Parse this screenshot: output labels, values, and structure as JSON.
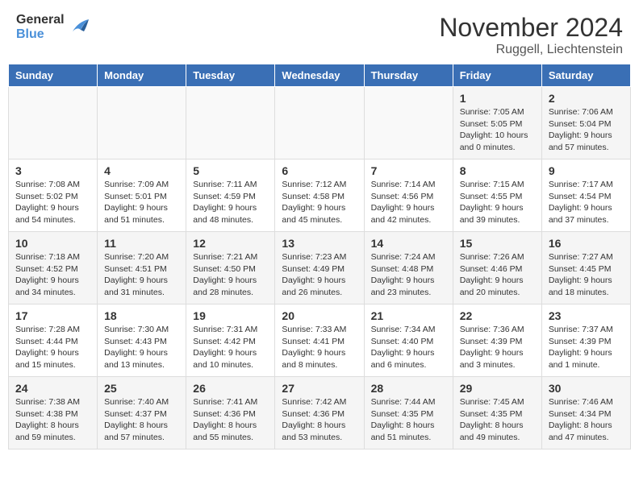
{
  "header": {
    "logo_general": "General",
    "logo_blue": "Blue",
    "month_title": "November 2024",
    "location": "Ruggell, Liechtenstein"
  },
  "weekdays": [
    "Sunday",
    "Monday",
    "Tuesday",
    "Wednesday",
    "Thursday",
    "Friday",
    "Saturday"
  ],
  "weeks": [
    [
      {
        "day": "",
        "info": ""
      },
      {
        "day": "",
        "info": ""
      },
      {
        "day": "",
        "info": ""
      },
      {
        "day": "",
        "info": ""
      },
      {
        "day": "",
        "info": ""
      },
      {
        "day": "1",
        "info": "Sunrise: 7:05 AM\nSunset: 5:05 PM\nDaylight: 10 hours and 0 minutes."
      },
      {
        "day": "2",
        "info": "Sunrise: 7:06 AM\nSunset: 5:04 PM\nDaylight: 9 hours and 57 minutes."
      }
    ],
    [
      {
        "day": "3",
        "info": "Sunrise: 7:08 AM\nSunset: 5:02 PM\nDaylight: 9 hours and 54 minutes."
      },
      {
        "day": "4",
        "info": "Sunrise: 7:09 AM\nSunset: 5:01 PM\nDaylight: 9 hours and 51 minutes."
      },
      {
        "day": "5",
        "info": "Sunrise: 7:11 AM\nSunset: 4:59 PM\nDaylight: 9 hours and 48 minutes."
      },
      {
        "day": "6",
        "info": "Sunrise: 7:12 AM\nSunset: 4:58 PM\nDaylight: 9 hours and 45 minutes."
      },
      {
        "day": "7",
        "info": "Sunrise: 7:14 AM\nSunset: 4:56 PM\nDaylight: 9 hours and 42 minutes."
      },
      {
        "day": "8",
        "info": "Sunrise: 7:15 AM\nSunset: 4:55 PM\nDaylight: 9 hours and 39 minutes."
      },
      {
        "day": "9",
        "info": "Sunrise: 7:17 AM\nSunset: 4:54 PM\nDaylight: 9 hours and 37 minutes."
      }
    ],
    [
      {
        "day": "10",
        "info": "Sunrise: 7:18 AM\nSunset: 4:52 PM\nDaylight: 9 hours and 34 minutes."
      },
      {
        "day": "11",
        "info": "Sunrise: 7:20 AM\nSunset: 4:51 PM\nDaylight: 9 hours and 31 minutes."
      },
      {
        "day": "12",
        "info": "Sunrise: 7:21 AM\nSunset: 4:50 PM\nDaylight: 9 hours and 28 minutes."
      },
      {
        "day": "13",
        "info": "Sunrise: 7:23 AM\nSunset: 4:49 PM\nDaylight: 9 hours and 26 minutes."
      },
      {
        "day": "14",
        "info": "Sunrise: 7:24 AM\nSunset: 4:48 PM\nDaylight: 9 hours and 23 minutes."
      },
      {
        "day": "15",
        "info": "Sunrise: 7:26 AM\nSunset: 4:46 PM\nDaylight: 9 hours and 20 minutes."
      },
      {
        "day": "16",
        "info": "Sunrise: 7:27 AM\nSunset: 4:45 PM\nDaylight: 9 hours and 18 minutes."
      }
    ],
    [
      {
        "day": "17",
        "info": "Sunrise: 7:28 AM\nSunset: 4:44 PM\nDaylight: 9 hours and 15 minutes."
      },
      {
        "day": "18",
        "info": "Sunrise: 7:30 AM\nSunset: 4:43 PM\nDaylight: 9 hours and 13 minutes."
      },
      {
        "day": "19",
        "info": "Sunrise: 7:31 AM\nSunset: 4:42 PM\nDaylight: 9 hours and 10 minutes."
      },
      {
        "day": "20",
        "info": "Sunrise: 7:33 AM\nSunset: 4:41 PM\nDaylight: 9 hours and 8 minutes."
      },
      {
        "day": "21",
        "info": "Sunrise: 7:34 AM\nSunset: 4:40 PM\nDaylight: 9 hours and 6 minutes."
      },
      {
        "day": "22",
        "info": "Sunrise: 7:36 AM\nSunset: 4:39 PM\nDaylight: 9 hours and 3 minutes."
      },
      {
        "day": "23",
        "info": "Sunrise: 7:37 AM\nSunset: 4:39 PM\nDaylight: 9 hours and 1 minute."
      }
    ],
    [
      {
        "day": "24",
        "info": "Sunrise: 7:38 AM\nSunset: 4:38 PM\nDaylight: 8 hours and 59 minutes."
      },
      {
        "day": "25",
        "info": "Sunrise: 7:40 AM\nSunset: 4:37 PM\nDaylight: 8 hours and 57 minutes."
      },
      {
        "day": "26",
        "info": "Sunrise: 7:41 AM\nSunset: 4:36 PM\nDaylight: 8 hours and 55 minutes."
      },
      {
        "day": "27",
        "info": "Sunrise: 7:42 AM\nSunset: 4:36 PM\nDaylight: 8 hours and 53 minutes."
      },
      {
        "day": "28",
        "info": "Sunrise: 7:44 AM\nSunset: 4:35 PM\nDaylight: 8 hours and 51 minutes."
      },
      {
        "day": "29",
        "info": "Sunrise: 7:45 AM\nSunset: 4:35 PM\nDaylight: 8 hours and 49 minutes."
      },
      {
        "day": "30",
        "info": "Sunrise: 7:46 AM\nSunset: 4:34 PM\nDaylight: 8 hours and 47 minutes."
      }
    ]
  ]
}
